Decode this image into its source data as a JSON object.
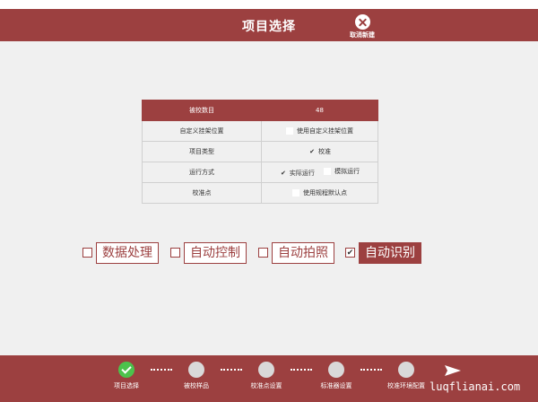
{
  "header": {
    "title": "项目选择",
    "cancel_label": "取消新建"
  },
  "params": {
    "rows": [
      {
        "key": "被校数目",
        "value": "48"
      },
      {
        "key": "自定义挂架位置",
        "option": {
          "checked": false,
          "label": "使用自定义挂架位置"
        }
      },
      {
        "key": "项目类型",
        "option": {
          "checked": true,
          "label": "校准"
        }
      },
      {
        "key": "运行方式",
        "options": [
          {
            "checked": true,
            "label": "实际运行"
          },
          {
            "checked": false,
            "label": "模拟运行"
          }
        ]
      },
      {
        "key": "校准点",
        "option": {
          "checked": false,
          "label": "使用规程默认点"
        }
      }
    ]
  },
  "tasks": [
    {
      "label": "数据处理",
      "checked": false
    },
    {
      "label": "自动控制",
      "checked": false
    },
    {
      "label": "自动拍照",
      "checked": false
    },
    {
      "label": "自动识别",
      "checked": true
    }
  ],
  "steps": [
    {
      "label": "项目选择",
      "state": "done"
    },
    {
      "label": "被校样品",
      "state": "pending"
    },
    {
      "label": "校准点设置",
      "state": "pending"
    },
    {
      "label": "标准器设置",
      "state": "pending"
    },
    {
      "label": "校准环境配置",
      "state": "pending"
    }
  ],
  "icons": {
    "cancel": "close-circle-icon",
    "next": "paper-plane-icon",
    "step_done": "check-icon"
  },
  "colors": {
    "primary": "#9c4040",
    "done": "#4cc24c",
    "background": "#f0f0f0"
  },
  "watermark": "luqflianai.com"
}
